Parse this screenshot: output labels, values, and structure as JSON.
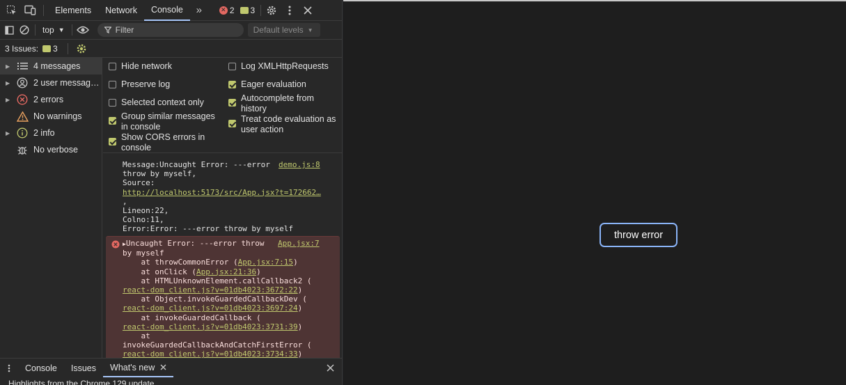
{
  "tabs": {
    "elements": "Elements",
    "network": "Network",
    "console": "Console",
    "error_count": "2",
    "message_count": "3"
  },
  "toolbar": {
    "context": "top",
    "filter_placeholder": "Filter",
    "levels": "Default levels"
  },
  "issues": {
    "label": "3 Issues:",
    "count": "3"
  },
  "sidebar": {
    "items": [
      {
        "label": "4 messages"
      },
      {
        "label": "2 user messag…"
      },
      {
        "label": "2 errors"
      },
      {
        "label": "No warnings"
      },
      {
        "label": "2 info"
      },
      {
        "label": "No verbose"
      }
    ]
  },
  "settings": {
    "hide_network": "Hide network",
    "preserve_log": "Preserve log",
    "selected_context": "Selected context only",
    "group_similar_1": "Group similar messages",
    "group_similar_2": "in console",
    "show_cors_1": "Show CORS errors in",
    "show_cors_2": "console",
    "log_xhr": "Log XMLHttpRequests",
    "eager_eval": "Eager evaluation",
    "autocomplete_1": "Autocomplete from",
    "autocomplete_2": "history",
    "treat_code_1": "Treat code evaluation as",
    "treat_code_2": "user action"
  },
  "log": {
    "line1": "Message:Uncaught Error: ---error",
    "source1": "demo.js:8",
    "line2": "throw by myself,",
    "line3": "Source:",
    "url": "http://localhost:5173/src/App.jsx?t=172662…",
    "line5": ",",
    "line6": "Lineon:22,",
    "line7": "Colno:11,",
    "line8": "Error:Error: ---error throw by myself"
  },
  "error": {
    "line1": "Uncaught Error: ---error throw",
    "source": "App.jsx:7",
    "line2": "by myself",
    "s1_pre": "    at throwCommonError (",
    "s1_link": "App.jsx:7:15",
    "s1_post": ")",
    "s2_pre": "    at onClick (",
    "s2_link": "App.jsx:21:36",
    "s2_post": ")",
    "s3": "    at HTMLUnknownElement.callCallback2 (",
    "s3_link": "react-dom_client.js?v=01db4023:3672:22",
    "s3_post": ")",
    "s4": "    at Object.invokeGuardedCallbackDev (",
    "s4_link": "react-dom_client.js?v=01db4023:3697:24",
    "s4_post": ")",
    "s5": "    at invokeGuardedCallback (",
    "s5_link": "react-dom_client.js?v=01db4023:3731:39",
    "s5_post": ")",
    "s6a": "    at",
    "s6": "invokeGuardedCallbackAndCatchFirstError (",
    "s6_link": "react-dom_client.js?v=01db4023:3734:33",
    "s6_post": ")"
  },
  "drawer": {
    "console": "Console",
    "issues": "Issues",
    "whats_new": "What's new",
    "highlight": "Highlights from the Chrome 129 update"
  },
  "page": {
    "button": "throw error"
  },
  "colors": {
    "accent": "#a8c7fa",
    "error": "#e46962",
    "message": "#c0c86e",
    "button_border": "#8ab4f8"
  }
}
